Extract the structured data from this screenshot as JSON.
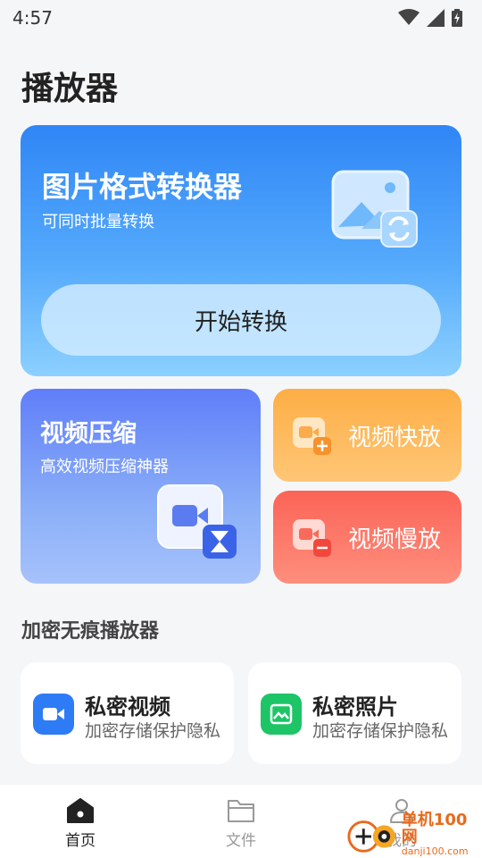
{
  "status_bar": {
    "time": "4:57",
    "icons": [
      "wifi-icon",
      "signal-icon",
      "battery-charging-icon"
    ]
  },
  "page_title": "播放器",
  "converter": {
    "title": "图片格式转换器",
    "subtitle": "可同时批量转换",
    "button_label": "开始转换",
    "icon": "image-convert-icon"
  },
  "compress": {
    "title": "视频压缩",
    "subtitle": "高效视频压缩神器",
    "icon": "video-hourglass-icon"
  },
  "fast_play": {
    "label": "视频快放",
    "icon": "video-plus-icon"
  },
  "slow_play": {
    "label": "视频慢放",
    "icon": "video-minus-icon"
  },
  "section_title": "加密无痕播放器",
  "private_video": {
    "title": "私密视频",
    "subtitle": "加密存储保护隐私",
    "icon": "video-camera-icon",
    "color": "#2e7bf6"
  },
  "private_photo": {
    "title": "私密照片",
    "subtitle": "加密存储保护隐私",
    "icon": "photo-icon",
    "color": "#1dc567"
  },
  "nav": {
    "items": [
      {
        "label": "首页",
        "icon": "home-icon",
        "active": true
      },
      {
        "label": "文件",
        "icon": "folder-icon",
        "active": false
      },
      {
        "label": "我的",
        "icon": "user-icon",
        "active": false
      }
    ]
  },
  "watermark": {
    "name": "单机100网",
    "url": "danji100.com"
  }
}
